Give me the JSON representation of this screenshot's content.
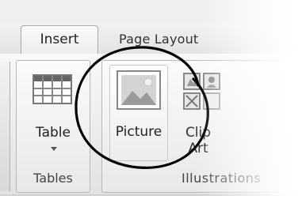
{
  "tabs": {
    "insert": "Insert",
    "page_layout": "Page Layout"
  },
  "groups": {
    "tables": {
      "label": "Tables",
      "table_button": "Table"
    },
    "illustrations": {
      "label": "Illustrations",
      "picture_button": "Picture",
      "clip_art_line1": "Clip",
      "clip_art_line2": "Art"
    }
  },
  "icons": {
    "table": "table-grid-icon",
    "picture": "picture-landscape-icon",
    "clip_art": "clip-art-icon",
    "dropdown": "chevron-down-icon"
  },
  "annotation": {
    "shape": "hand-drawn circle",
    "color": "#000000"
  }
}
